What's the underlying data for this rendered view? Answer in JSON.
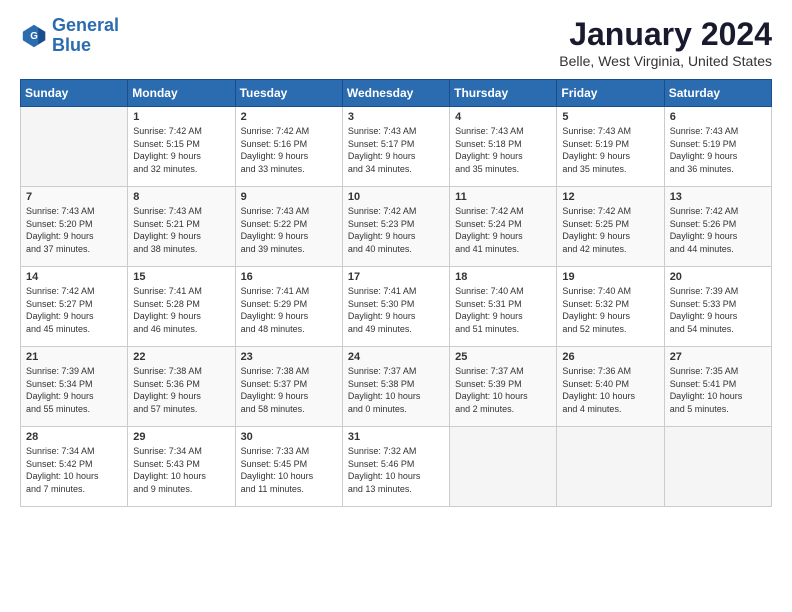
{
  "logo": {
    "line1": "General",
    "line2": "Blue"
  },
  "title": "January 2024",
  "location": "Belle, West Virginia, United States",
  "weekdays": [
    "Sunday",
    "Monday",
    "Tuesday",
    "Wednesday",
    "Thursday",
    "Friday",
    "Saturday"
  ],
  "weeks": [
    [
      {
        "day": "",
        "info": ""
      },
      {
        "day": "1",
        "info": "Sunrise: 7:42 AM\nSunset: 5:15 PM\nDaylight: 9 hours\nand 32 minutes."
      },
      {
        "day": "2",
        "info": "Sunrise: 7:42 AM\nSunset: 5:16 PM\nDaylight: 9 hours\nand 33 minutes."
      },
      {
        "day": "3",
        "info": "Sunrise: 7:43 AM\nSunset: 5:17 PM\nDaylight: 9 hours\nand 34 minutes."
      },
      {
        "day": "4",
        "info": "Sunrise: 7:43 AM\nSunset: 5:18 PM\nDaylight: 9 hours\nand 35 minutes."
      },
      {
        "day": "5",
        "info": "Sunrise: 7:43 AM\nSunset: 5:19 PM\nDaylight: 9 hours\nand 35 minutes."
      },
      {
        "day": "6",
        "info": "Sunrise: 7:43 AM\nSunset: 5:19 PM\nDaylight: 9 hours\nand 36 minutes."
      }
    ],
    [
      {
        "day": "7",
        "info": "Sunrise: 7:43 AM\nSunset: 5:20 PM\nDaylight: 9 hours\nand 37 minutes."
      },
      {
        "day": "8",
        "info": "Sunrise: 7:43 AM\nSunset: 5:21 PM\nDaylight: 9 hours\nand 38 minutes."
      },
      {
        "day": "9",
        "info": "Sunrise: 7:43 AM\nSunset: 5:22 PM\nDaylight: 9 hours\nand 39 minutes."
      },
      {
        "day": "10",
        "info": "Sunrise: 7:42 AM\nSunset: 5:23 PM\nDaylight: 9 hours\nand 40 minutes."
      },
      {
        "day": "11",
        "info": "Sunrise: 7:42 AM\nSunset: 5:24 PM\nDaylight: 9 hours\nand 41 minutes."
      },
      {
        "day": "12",
        "info": "Sunrise: 7:42 AM\nSunset: 5:25 PM\nDaylight: 9 hours\nand 42 minutes."
      },
      {
        "day": "13",
        "info": "Sunrise: 7:42 AM\nSunset: 5:26 PM\nDaylight: 9 hours\nand 44 minutes."
      }
    ],
    [
      {
        "day": "14",
        "info": "Sunrise: 7:42 AM\nSunset: 5:27 PM\nDaylight: 9 hours\nand 45 minutes."
      },
      {
        "day": "15",
        "info": "Sunrise: 7:41 AM\nSunset: 5:28 PM\nDaylight: 9 hours\nand 46 minutes."
      },
      {
        "day": "16",
        "info": "Sunrise: 7:41 AM\nSunset: 5:29 PM\nDaylight: 9 hours\nand 48 minutes."
      },
      {
        "day": "17",
        "info": "Sunrise: 7:41 AM\nSunset: 5:30 PM\nDaylight: 9 hours\nand 49 minutes."
      },
      {
        "day": "18",
        "info": "Sunrise: 7:40 AM\nSunset: 5:31 PM\nDaylight: 9 hours\nand 51 minutes."
      },
      {
        "day": "19",
        "info": "Sunrise: 7:40 AM\nSunset: 5:32 PM\nDaylight: 9 hours\nand 52 minutes."
      },
      {
        "day": "20",
        "info": "Sunrise: 7:39 AM\nSunset: 5:33 PM\nDaylight: 9 hours\nand 54 minutes."
      }
    ],
    [
      {
        "day": "21",
        "info": "Sunrise: 7:39 AM\nSunset: 5:34 PM\nDaylight: 9 hours\nand 55 minutes."
      },
      {
        "day": "22",
        "info": "Sunrise: 7:38 AM\nSunset: 5:36 PM\nDaylight: 9 hours\nand 57 minutes."
      },
      {
        "day": "23",
        "info": "Sunrise: 7:38 AM\nSunset: 5:37 PM\nDaylight: 9 hours\nand 58 minutes."
      },
      {
        "day": "24",
        "info": "Sunrise: 7:37 AM\nSunset: 5:38 PM\nDaylight: 10 hours\nand 0 minutes."
      },
      {
        "day": "25",
        "info": "Sunrise: 7:37 AM\nSunset: 5:39 PM\nDaylight: 10 hours\nand 2 minutes."
      },
      {
        "day": "26",
        "info": "Sunrise: 7:36 AM\nSunset: 5:40 PM\nDaylight: 10 hours\nand 4 minutes."
      },
      {
        "day": "27",
        "info": "Sunrise: 7:35 AM\nSunset: 5:41 PM\nDaylight: 10 hours\nand 5 minutes."
      }
    ],
    [
      {
        "day": "28",
        "info": "Sunrise: 7:34 AM\nSunset: 5:42 PM\nDaylight: 10 hours\nand 7 minutes."
      },
      {
        "day": "29",
        "info": "Sunrise: 7:34 AM\nSunset: 5:43 PM\nDaylight: 10 hours\nand 9 minutes."
      },
      {
        "day": "30",
        "info": "Sunrise: 7:33 AM\nSunset: 5:45 PM\nDaylight: 10 hours\nand 11 minutes."
      },
      {
        "day": "31",
        "info": "Sunrise: 7:32 AM\nSunset: 5:46 PM\nDaylight: 10 hours\nand 13 minutes."
      },
      {
        "day": "",
        "info": ""
      },
      {
        "day": "",
        "info": ""
      },
      {
        "day": "",
        "info": ""
      }
    ]
  ]
}
